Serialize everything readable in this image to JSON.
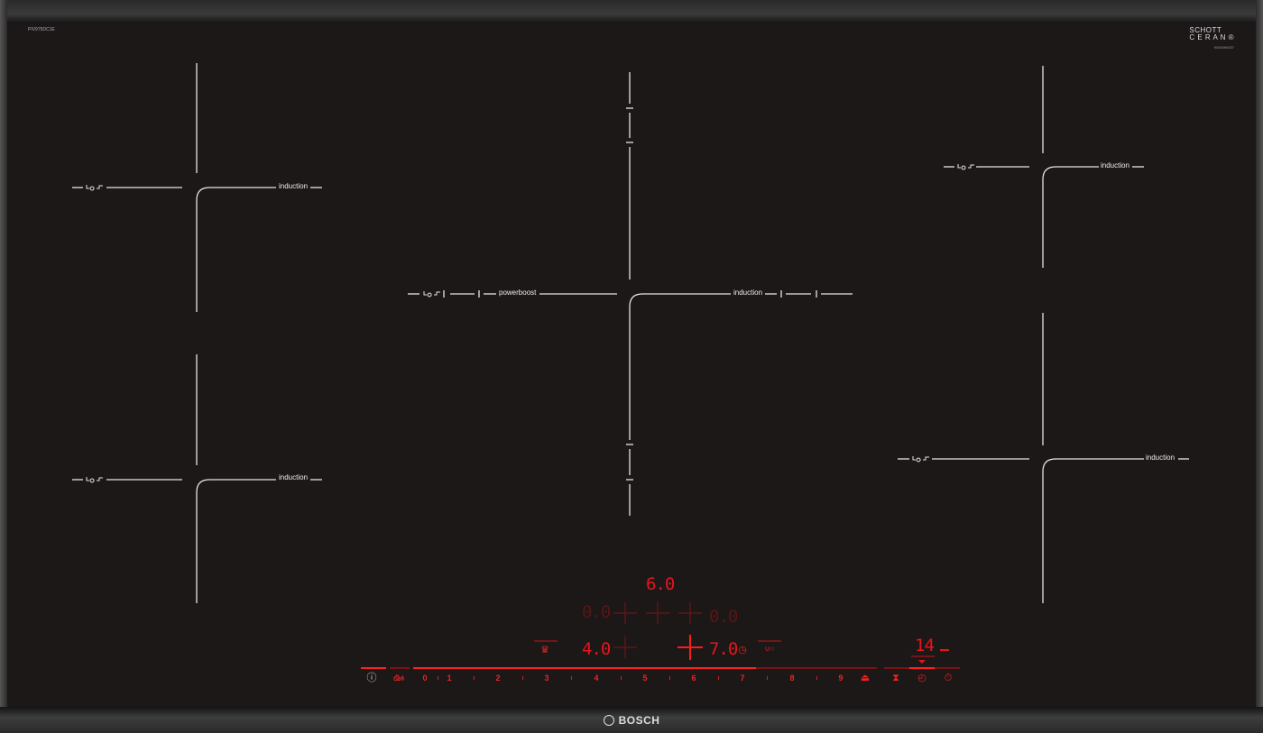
{
  "panel": {
    "model_code": "PIV975DC1E",
    "glass_brand": "SCHOTT\nCERAN®",
    "glass_code": "9000096337",
    "brand_name": "BOSCH"
  },
  "zones": {
    "left_top_label": "induction",
    "left_bottom_label": "induction",
    "center_left_label": "powerboost",
    "center_right_label": "induction",
    "right_top_label": "induction",
    "right_bottom_label": "induction"
  },
  "displays": {
    "top": "6.0",
    "middle_left": "0.0",
    "middle_right": "0.0",
    "lower_left": "4.0",
    "lower_right": "7.0",
    "timer": "14"
  },
  "control_bar": {
    "info_icon": "info-icon",
    "child_lock_icon": "child-lock-icon",
    "levels": [
      "0",
      "1",
      "2",
      "3",
      "4",
      "5",
      "6",
      "7",
      "8",
      "9"
    ],
    "boost_icon": "boost-icon",
    "timer_icons": [
      "cooking-sensor-icon",
      "timer-icon",
      "stopwatch-icon"
    ],
    "active_color": "#e8141c"
  }
}
